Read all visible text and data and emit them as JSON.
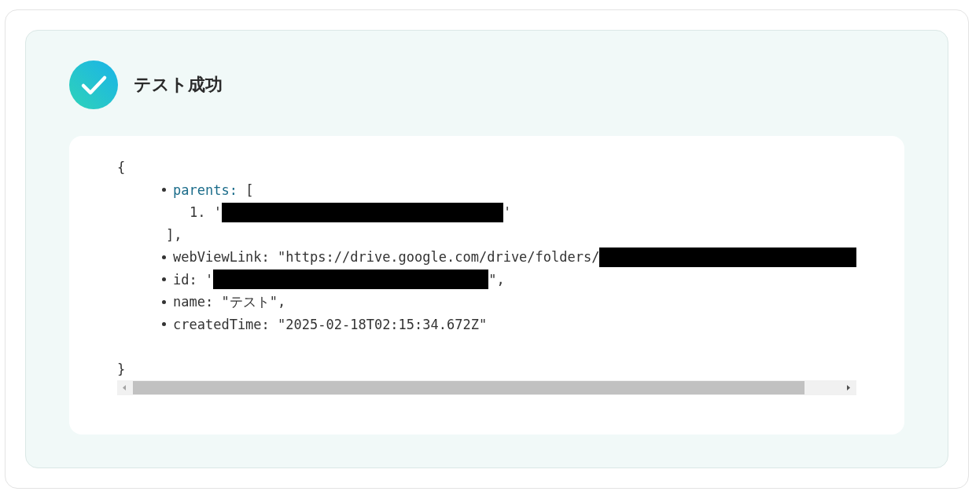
{
  "status": {
    "title": "テスト成功"
  },
  "output": {
    "open": "{",
    "close": "}",
    "fields": [
      {
        "key": "parents:",
        "highlighted": true,
        "kind": "array",
        "open": "[",
        "items": [
          {
            "marker": "1.",
            "prefix": "'",
            "redacted": true,
            "suffix": "'"
          }
        ],
        "close": "],"
      },
      {
        "key": "webViewLink:",
        "highlighted": false,
        "kind": "value",
        "prefix": "\"https://drive.google.com/drive/folders/",
        "redacted": true
      },
      {
        "key": "id:",
        "highlighted": false,
        "kind": "value",
        "prefix": "'",
        "redacted": true,
        "suffix": "\","
      },
      {
        "key": "name:",
        "highlighted": false,
        "kind": "value",
        "prefix": "\"テスト\","
      },
      {
        "key": "createdTime:",
        "highlighted": false,
        "kind": "value",
        "prefix": "\"2025-02-18T02:15:34.672Z\""
      }
    ]
  }
}
